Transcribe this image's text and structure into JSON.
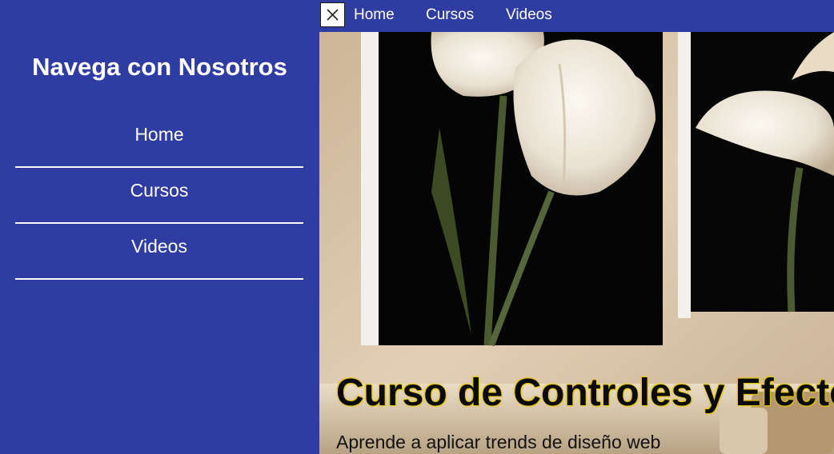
{
  "sidebar": {
    "title": "Navega con Nosotros",
    "items": [
      {
        "label": "Home"
      },
      {
        "label": "Cursos"
      },
      {
        "label": "Videos"
      }
    ]
  },
  "topbar": {
    "close_icon": "close-icon",
    "nav": [
      {
        "label": "Home"
      },
      {
        "label": "Cursos"
      },
      {
        "label": "Videos"
      }
    ]
  },
  "hero": {
    "image": "tulip-canvas-photo",
    "title": "Curso de Controles y Efectos",
    "subtitle": "Aprende a aplicar trends de diseño web"
  },
  "colors": {
    "brand": "#2f3ca1",
    "title_glow": "#e6c400"
  }
}
